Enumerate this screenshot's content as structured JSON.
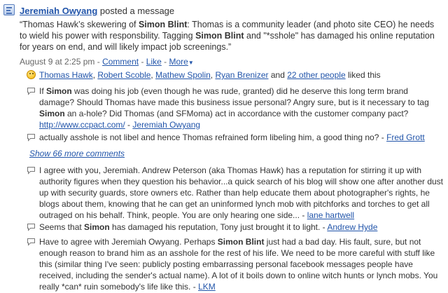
{
  "post": {
    "author": "Jeremiah Owyang",
    "action": "posted a message",
    "quote": {
      "p1": "“Thomas Hawk’s skewering of ",
      "b1": "Simon Blint",
      "p2": ": Thomas is a community leader (and photo site CEO) he needs to wield his power with responsbility. Tagging ",
      "b2": "Simon Blint",
      "p3": " and \"*sshole\" has damaged his online reputation for years on end, and will likely impact job screenings.”"
    },
    "meta": {
      "time": "August 9 at 2:25 pm",
      "comment": "Comment",
      "like": "Like",
      "more": "More",
      "sep": "-"
    }
  },
  "likes": {
    "people": [
      "Thomas Hawk",
      "Robert Scoble",
      "Mathew Spolin",
      "Ryan Brenizer"
    ],
    "and": "and",
    "others": "22 other people",
    "suffix": "liked this"
  },
  "comments": [
    {
      "t1": "If ",
      "b1": "Simon",
      "t2": " was doing his job (even though he was rude, granted) did he deserve this long term brand damage? Should Thomas have made this business issue personal? Angry sure, but is it necessary to tag ",
      "b2": "Simon",
      "t3": " an a-hole? Did Thomas (and SFMoma) act in accordance with the customer company pact? ",
      "url": "http://www.ccpact.com/",
      "dash": " - ",
      "author": "Jeremiah Owyang"
    },
    {
      "text": "actually asshole is not libel and hence Thomas refrained form libeling him, a good thing no? - ",
      "author": "Fred Grott"
    },
    {
      "text": "I agree with you, Jeremiah. Andrew Peterson (aka Thomas Hawk) has a reputation for stirring it up with authority figures when they question his behavior...a quick search of his blog will show one after another dust up with security guards, store owners etc. Rather than help educate them about photographer's rights, he blogs about them, knowing that he can get an uninformed lynch mob with pitchforks and torches to get all outraged on his behalf. Think, people. You are only hearing one side... - ",
      "author": "lane hartwell"
    },
    {
      "t1": "Seems that ",
      "b1": "Simon",
      "t2": " has damaged his reputation, Tony just brought it to light. - ",
      "author": "Andrew Hyde"
    },
    {
      "t1": "Have to agree with Jeremiah Owyang. Perhaps ",
      "b1": "Simon Blint",
      "t2": " just had a bad day. His fault, sure, but not enough reason to brand him as an asshole for the rest of his life. We need to be more careful with stuff like this (similar thing I've seen: publicly posting embarrassing personal facebook messages people have received, including the sender's actual name). A lot of it boils down to online witch hunts or lynch mobs. You really *can* ruin somebody's life like this. - ",
      "author": "LKM"
    }
  ],
  "show_more": "Show 66 more comments",
  "icons": {
    "app": "app-icon",
    "like": "smiley-icon",
    "comment": "comment-bubble-icon"
  }
}
